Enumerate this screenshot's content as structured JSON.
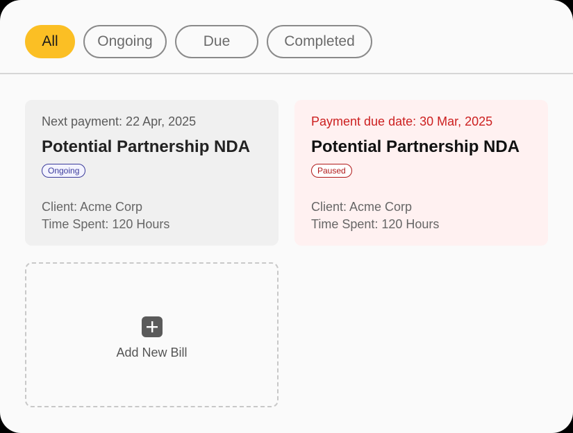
{
  "filters": {
    "all": "All",
    "ongoing": "Ongoing",
    "due": "Due",
    "completed": "Completed",
    "active": "All"
  },
  "colors": {
    "accent": "#fbbf24",
    "due_text": "#cc1f1f",
    "ongoing_badge": "#3a3a9a",
    "paused_badge": "#b01818"
  },
  "bills": [
    {
      "meta": "Next payment: 22 Apr, 2025",
      "title": "Potential Partnership NDA",
      "status": "Ongoing",
      "client": "Client: Acme Corp",
      "time_spent": "Time Spent: 120 Hours"
    },
    {
      "meta": "Payment due date: 30 Mar, 2025",
      "title": "Potential Partnership NDA",
      "status": "Paused",
      "client": "Client: Acme Corp",
      "time_spent": "Time Spent: 120 Hours"
    }
  ],
  "add_bill": {
    "icon": "plus-icon",
    "label": "Add New Bill"
  }
}
